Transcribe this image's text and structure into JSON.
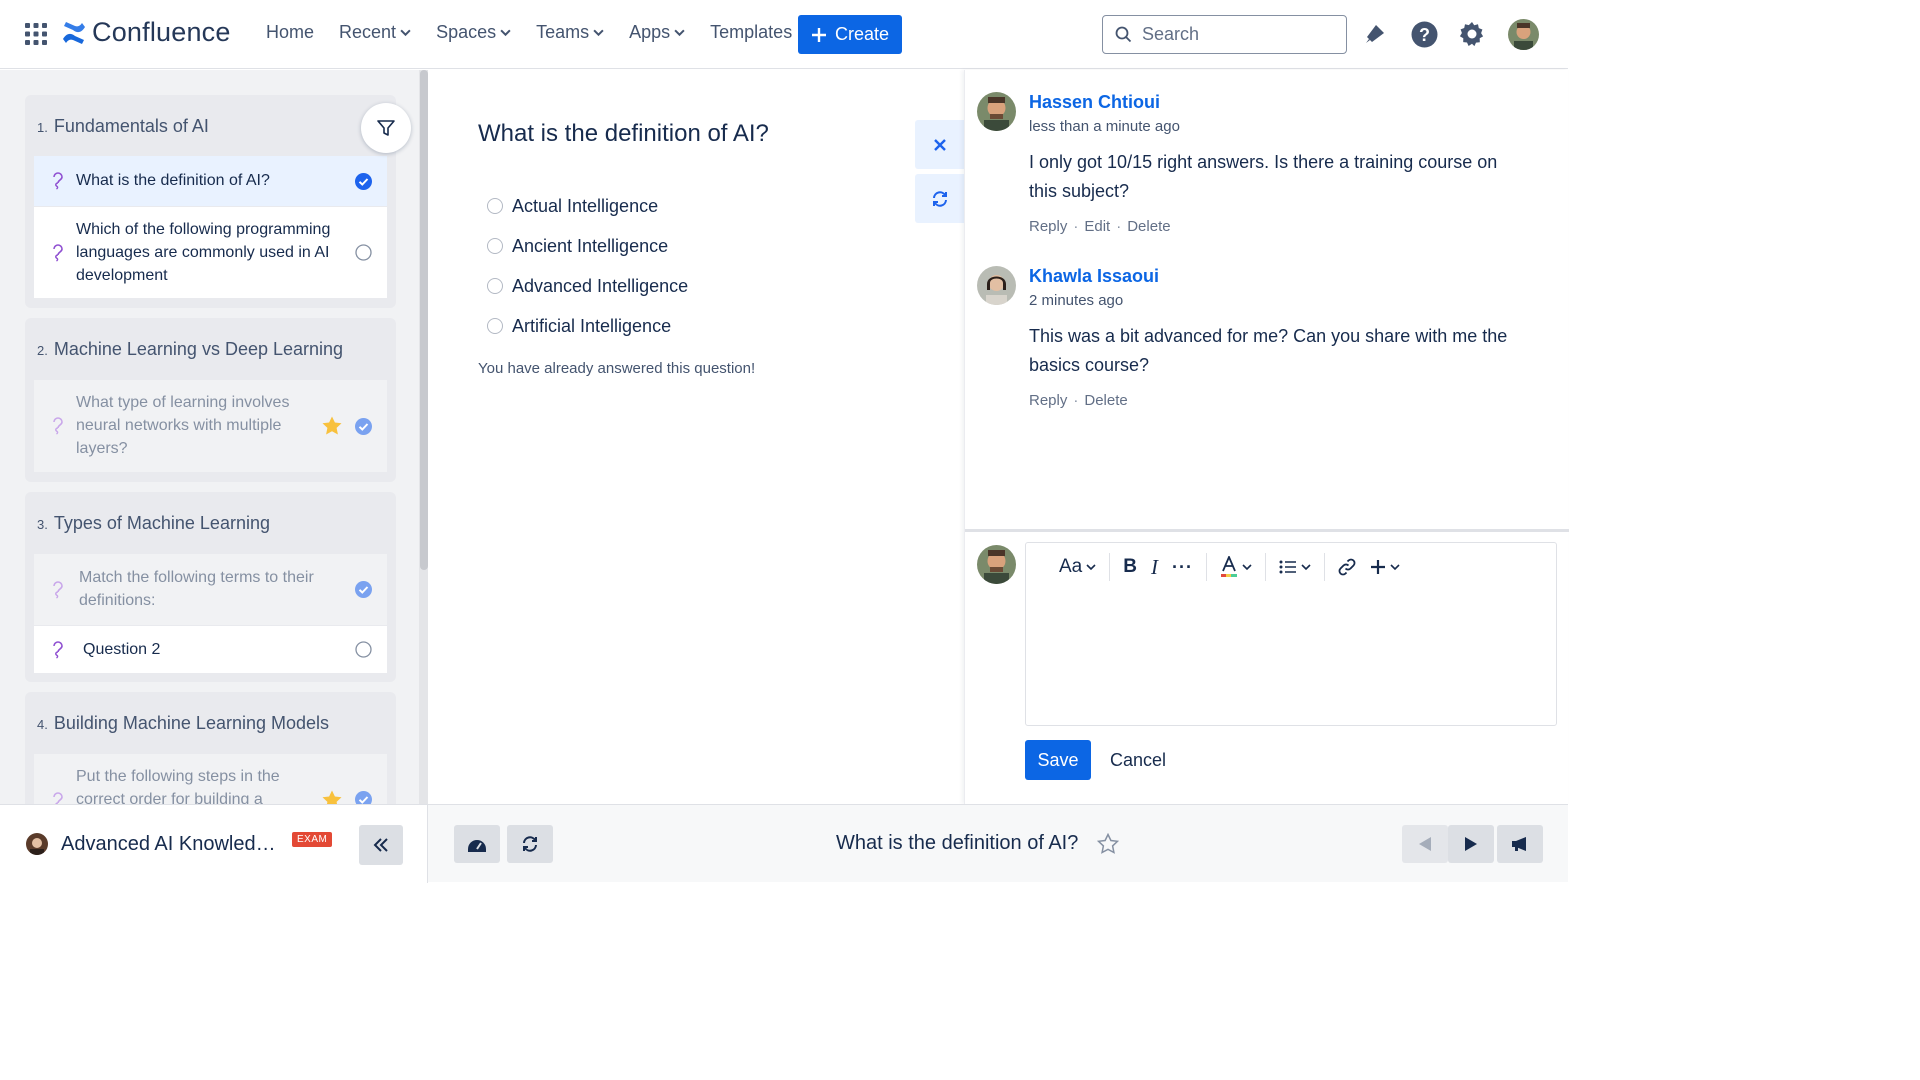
{
  "nav": {
    "brand": "Confluence",
    "links": [
      {
        "label": "Home",
        "has_menu": false
      },
      {
        "label": "Recent",
        "has_menu": true
      },
      {
        "label": "Spaces",
        "has_menu": true
      },
      {
        "label": "Teams",
        "has_menu": true
      },
      {
        "label": "Apps",
        "has_menu": true
      },
      {
        "label": "Templates",
        "has_menu": false
      }
    ],
    "create_label": "Create",
    "search_placeholder": "Search",
    "icons": [
      "app-switcher-icon",
      "notifications-icon",
      "help-icon",
      "settings-icon",
      "profile-avatar"
    ]
  },
  "sidebar": {
    "sections": [
      {
        "number": "1.",
        "title": "Fundamentals of AI",
        "questions": [
          {
            "text": "What is the definition of AI?",
            "status": "answered",
            "state": "active"
          },
          {
            "text": "Which of the following programming languages are commonly used in AI development",
            "status": "unanswered",
            "state": "normal"
          }
        ]
      },
      {
        "number": "2.",
        "title": "Machine Learning vs Deep Learning",
        "questions": [
          {
            "text": "What type of learning involves neural networks with multiple layers?",
            "status": "answered",
            "starred": true,
            "state": "muted"
          }
        ]
      },
      {
        "number": "3.",
        "title": "Types of Machine Learning",
        "questions": [
          {
            "text": "Match the following terms to their definitions:",
            "status": "answered",
            "state": "muted"
          },
          {
            "text": "Question 2",
            "status": "unanswered",
            "state": "normal"
          }
        ]
      },
      {
        "number": "4.",
        "title": "Building Machine Learning Models",
        "questions": [
          {
            "text": "Put the following steps in the correct order for building a",
            "status": "answered",
            "starred": true,
            "state": "muted"
          }
        ]
      }
    ]
  },
  "question": {
    "title": "What is the definition of AI?",
    "options": [
      "Actual Intelligence",
      "Ancient Intelligence",
      "Advanced Intelligence",
      "Artificial Intelligence"
    ],
    "note": "You have already answered this question!"
  },
  "comments": [
    {
      "author": "Hassen Chtioui",
      "time": "less than a minute ago",
      "body": "I only got 10/15 right answers. Is there a training course on this subject?",
      "actions": [
        "Reply",
        "Edit",
        "Delete"
      ]
    },
    {
      "author": "Khawla Issaoui",
      "time": "2 minutes ago",
      "body": "This was a bit advanced for me? Can you share with me the basics course?",
      "actions": [
        "Reply",
        "Delete"
      ]
    }
  ],
  "editor": {
    "text_style_label": "Aa",
    "save_label": "Save",
    "cancel_label": "Cancel"
  },
  "bottom": {
    "course_title": "Advanced AI Knowledge...",
    "badge": "EXAM",
    "current_question": "What is the definition of AI?"
  },
  "colors": {
    "primary": "#0c66e4",
    "star": "#f8c13d",
    "check": "#1d63ed",
    "badge": "#e34935"
  }
}
